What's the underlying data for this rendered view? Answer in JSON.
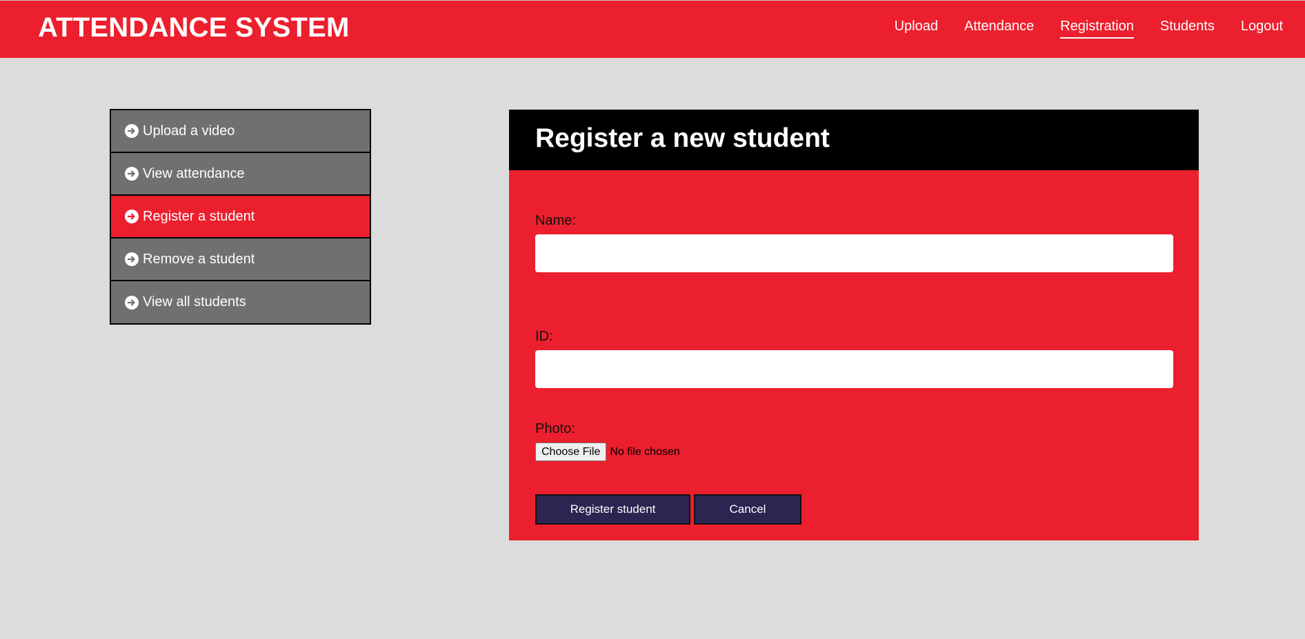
{
  "header": {
    "brand": "ATTENDANCE SYSTEM",
    "nav": [
      {
        "label": "Upload",
        "active": false
      },
      {
        "label": "Attendance",
        "active": false
      },
      {
        "label": "Registration",
        "active": true
      },
      {
        "label": "Students",
        "active": false
      },
      {
        "label": "Logout",
        "active": false
      }
    ]
  },
  "sidebar": {
    "icon": "arrow-circle-right-icon",
    "items": [
      {
        "label": "Upload a video",
        "active": false
      },
      {
        "label": "View attendance",
        "active": false
      },
      {
        "label": "Register a student",
        "active": true
      },
      {
        "label": "Remove a student",
        "active": false
      },
      {
        "label": "View all students",
        "active": false
      }
    ]
  },
  "form": {
    "title": "Register a new student",
    "name_label": "Name:",
    "name_value": "",
    "id_label": "ID:",
    "id_value": "",
    "photo_label": "Photo:",
    "file_button": "Choose File",
    "file_status": "No file chosen",
    "submit_label": "Register student",
    "cancel_label": "Cancel"
  },
  "colors": {
    "primary_red": "#ec1f2e",
    "background": "#dcdcdc",
    "menu_gray": "#707070",
    "button_navy": "#2e2452",
    "panel_header": "#000000"
  }
}
